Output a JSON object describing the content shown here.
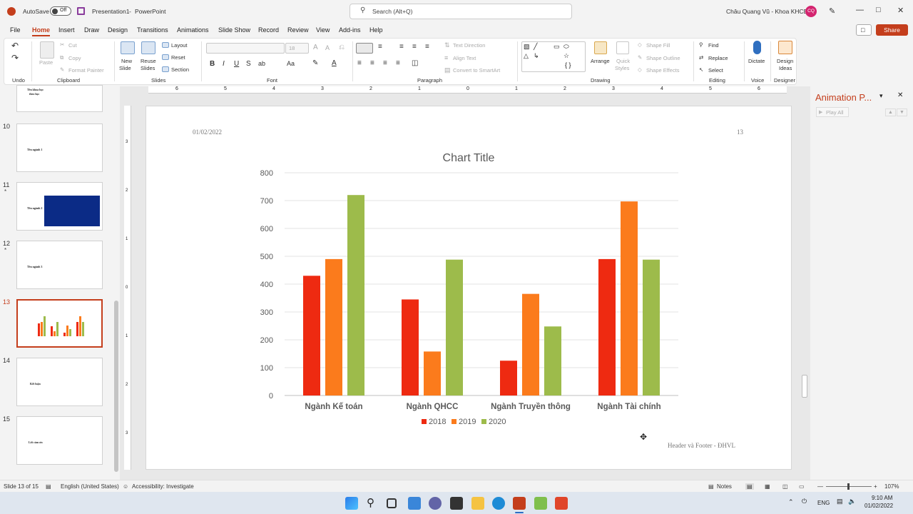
{
  "titlebar": {
    "autosave_label": "AutoSave",
    "autosave_state": "Off",
    "doc_title": "Presentation1",
    "separator": "-",
    "app_name": "PowerPoint",
    "search_placeholder": "Search (Alt+Q)",
    "user_name": "Châu Quang Vũ - Khoa KHCB",
    "user_initials": "CQ"
  },
  "menu": {
    "tabs": [
      "File",
      "Home",
      "Insert",
      "Draw",
      "Design",
      "Transitions",
      "Animations",
      "Slide Show",
      "Record",
      "Review",
      "View",
      "Add-ins",
      "Help"
    ],
    "active": "Home",
    "share_label": "Share"
  },
  "ribbon": {
    "groups": {
      "undo": "Undo",
      "clipboard": "Clipboard",
      "slides": "Slides",
      "font": "Font",
      "paragraph": "Paragraph",
      "drawing": "Drawing",
      "editing": "Editing",
      "voice": "Voice",
      "designer": "Designer"
    },
    "clipboard": {
      "paste": "Paste",
      "cut": "Cut",
      "copy": "Copy",
      "format_painter": "Format Painter"
    },
    "slides": {
      "new_slide": "New",
      "new_slide2": "Slide",
      "reuse": "Reuse",
      "reuse2": "Slides",
      "layout": "Layout",
      "reset": "Reset",
      "section": "Section"
    },
    "font": {
      "size": "18"
    },
    "paragraph": {
      "text_direction": "Text Direction",
      "align_text": "Align Text",
      "smartart": "Convert to SmartArt"
    },
    "drawing": {
      "arrange": "Arrange",
      "quick_styles": "Quick",
      "quick_styles2": "Styles",
      "shape_fill": "Shape Fill",
      "shape_outline": "Shape Outline",
      "shape_effects": "Shape Effects"
    },
    "editing": {
      "find": "Find",
      "replace": "Replace",
      "select": "Select"
    },
    "voice": {
      "dictate": "Dictate"
    },
    "designer": {
      "design_ideas": "Design",
      "design_ideas2": "Ideas"
    }
  },
  "ruler": {
    "marks": [
      "6",
      "5",
      "4",
      "3",
      "2",
      "1",
      "0",
      "1",
      "2",
      "3",
      "4",
      "5",
      "6"
    ],
    "vmarks": [
      "3",
      "2",
      "1",
      "0",
      "1",
      "2",
      "3"
    ]
  },
  "thumbnails": [
    {
      "num": "",
      "text1": "Tên khoa học",
      "text2": "theo học",
      "star": false
    },
    {
      "num": "10",
      "text1": "Tên ngành 1",
      "text2": "",
      "star": false
    },
    {
      "num": "11",
      "text1": "Tên ngành 2",
      "text2": "",
      "star": true
    },
    {
      "num": "12",
      "text1": "Tên ngành 3",
      "text2": "",
      "star": true
    },
    {
      "num": "13",
      "text1": "",
      "text2": "",
      "star": false
    },
    {
      "num": "14",
      "text1": "Kết luận",
      "text2": "",
      "star": false
    },
    {
      "num": "15",
      "text1": "Lời cảm ơn",
      "text2": "",
      "star": false
    }
  ],
  "star_glyph": "*",
  "slide": {
    "date": "01/02/2022",
    "page_number": "13",
    "footer": "Header và Footer - ĐHVL"
  },
  "chart_data": {
    "type": "bar",
    "title": "Chart Title",
    "categories": [
      "Ngành Kế toán",
      "Ngành QHCC",
      "Ngành Truyền thông",
      "Ngành Tài chính"
    ],
    "series": [
      {
        "name": "2018",
        "values": [
          430,
          345,
          125,
          490
        ],
        "color": "#ee2a11"
      },
      {
        "name": "2019",
        "values": [
          490,
          158,
          365,
          697
        ],
        "color": "#fb7b1c"
      },
      {
        "name": "2020",
        "values": [
          720,
          488,
          248,
          488
        ],
        "color": "#9dbb4b"
      }
    ],
    "ylim": [
      0,
      800
    ],
    "yticks": [
      "0",
      "100",
      "200",
      "300",
      "400",
      "500",
      "600",
      "700",
      "800"
    ],
    "grid": true,
    "legend": "bottom"
  },
  "anim_pane": {
    "title": "Animation P...",
    "play_all": "Play All"
  },
  "statusbar": {
    "slide_info": "Slide 13 of 15",
    "language": "English (United States)",
    "accessibility": "Accessibility: Investigate",
    "notes": "Notes",
    "zoom": "107%"
  },
  "taskbar": {
    "lang": "ENG",
    "time": "9:10 AM",
    "date": "01/02/2022"
  }
}
